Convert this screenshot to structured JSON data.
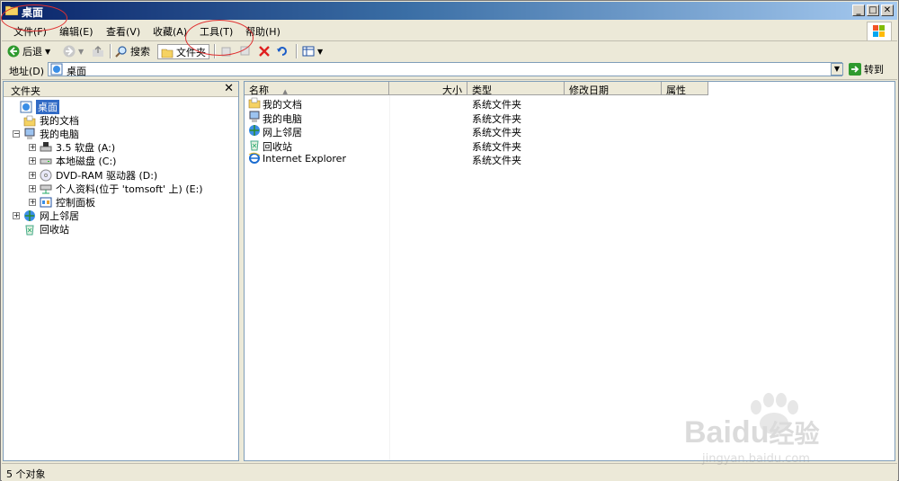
{
  "window": {
    "title": "桌面"
  },
  "menu": [
    "文件(F)",
    "编辑(E)",
    "查看(V)",
    "收藏(A)",
    "工具(T)",
    "帮助(H)"
  ],
  "toolbar": {
    "back": "后退",
    "search": "搜索",
    "folders": "文件夹"
  },
  "address": {
    "label": "地址(D)",
    "value": "桌面",
    "go": "转到"
  },
  "folders_pane": {
    "title": "文件夹",
    "close": "✕",
    "tree": [
      {
        "label": "桌面",
        "level": 0,
        "icon": "desktop-icon",
        "expander": "",
        "selected": true
      },
      {
        "label": "我的文档",
        "level": 1,
        "icon": "my-documents-icon",
        "expander": ""
      },
      {
        "label": "我的电脑",
        "level": 1,
        "icon": "my-computer-icon",
        "expander": "−"
      },
      {
        "label": "3.5 软盘 (A:)",
        "level": 2,
        "icon": "floppy-drive-icon",
        "expander": "+"
      },
      {
        "label": "本地磁盘 (C:)",
        "level": 2,
        "icon": "local-disk-icon",
        "expander": "+"
      },
      {
        "label": "DVD-RAM 驱动器 (D:)",
        "level": 2,
        "icon": "dvd-drive-icon",
        "expander": "+"
      },
      {
        "label": "个人资料(位于 'tomsoft' 上) (E:)",
        "level": 2,
        "icon": "network-drive-icon",
        "expander": "+"
      },
      {
        "label": "控制面板",
        "level": 2,
        "icon": "control-panel-icon",
        "expander": "+"
      },
      {
        "label": "网上邻居",
        "level": 1,
        "icon": "network-places-icon",
        "expander": "+"
      },
      {
        "label": "回收站",
        "level": 1,
        "icon": "recycle-bin-icon",
        "expander": ""
      }
    ]
  },
  "columns": [
    "名称",
    "大小",
    "类型",
    "修改日期",
    "属性"
  ],
  "sort_indicator": "▲",
  "files": [
    {
      "name": "我的文档",
      "type": "系统文件夹",
      "icon": "my-documents-icon"
    },
    {
      "name": "我的电脑",
      "type": "系统文件夹",
      "icon": "my-computer-icon"
    },
    {
      "name": "网上邻居",
      "type": "系统文件夹",
      "icon": "network-places-icon"
    },
    {
      "name": "回收站",
      "type": "系统文件夹",
      "icon": "recycle-bin-icon"
    },
    {
      "name": "Internet Explorer",
      "type": "系统文件夹",
      "icon": "internet-explorer-icon"
    }
  ],
  "status": {
    "text": "5 个对象"
  },
  "watermark": {
    "brand": "Bai",
    "brand2": "du",
    "cn": "经验",
    "url": "jingyan.baidu.com"
  },
  "colors": {
    "title_start": "#0a246a",
    "title_end": "#a6caf0",
    "selection": "#316ac5"
  }
}
